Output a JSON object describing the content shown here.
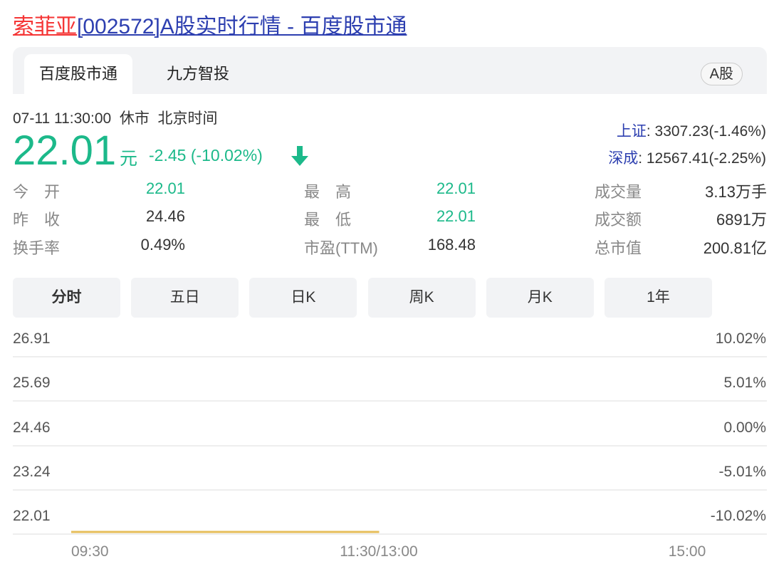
{
  "title": {
    "name": "索菲亚",
    "rest": "[002572]A股实时行情 - 百度股市通"
  },
  "tabs": [
    "百度股市通",
    "九方智投"
  ],
  "market_pill": "A股",
  "info": "07-11 11:30:00  休市  北京时间",
  "price": "22.01",
  "unit": "元",
  "change": "-2.45 (-10.02%)",
  "indices": [
    {
      "name": "上证",
      "value": ": 3307.23(-1.46%)"
    },
    {
      "name": "深成",
      "value": ": 12567.41(-2.25%)"
    }
  ],
  "stats": [
    [
      {
        "label": "今　开",
        "value": "22.01",
        "color": "green"
      },
      {
        "label": "最　高",
        "value": "22.01",
        "color": "green"
      },
      {
        "label": "成交量",
        "value": "3.13万手"
      }
    ],
    [
      {
        "label": "昨　收",
        "value": "24.46"
      },
      {
        "label": "最　低",
        "value": "22.01",
        "color": "green"
      },
      {
        "label": "成交额",
        "value": "6891万"
      }
    ],
    [
      {
        "label": "换手率",
        "value": "0.49%"
      },
      {
        "label": "市盈(TTM)",
        "value": "168.48"
      },
      {
        "label": "总市值",
        "value": "200.81亿"
      }
    ]
  ],
  "period_tabs": [
    "分时",
    "五日",
    "日K",
    "周K",
    "月K",
    "1年"
  ],
  "chart_data": {
    "type": "line",
    "y_left_ticks": [
      "26.91",
      "25.69",
      "24.46",
      "23.24",
      "22.01"
    ],
    "y_right_ticks": [
      "10.02%",
      "5.01%",
      "0.00%",
      "-5.01%",
      "-10.02%"
    ],
    "x_ticks": [
      "09:30",
      "11:30/13:00",
      "15:00"
    ],
    "ylim": [
      22.01,
      26.91
    ],
    "series": [
      {
        "name": "price",
        "x_minutes": [
          0,
          120
        ],
        "values": [
          22.01,
          22.01
        ],
        "color": "#e6be5a"
      }
    ]
  }
}
